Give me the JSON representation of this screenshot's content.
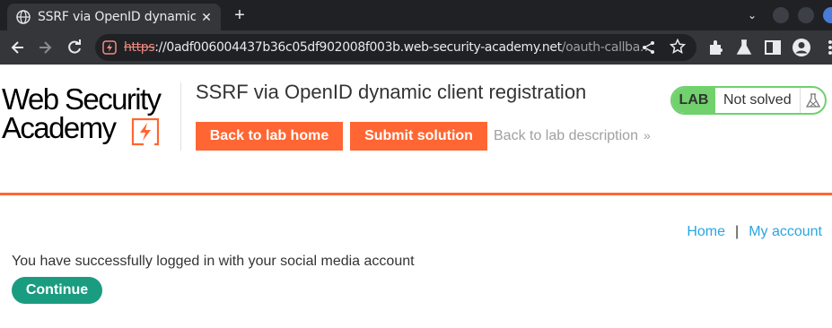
{
  "browser": {
    "tab_title": "SSRF via OpenID dynamic client registration",
    "tab_close_glyph": "✕",
    "new_tab_glyph": "+",
    "tabs_menu_glyph": "⌄",
    "url_scheme": "https",
    "url_host": "://0adf006004437b36c05df902008f003b.web-security-academy.net",
    "url_path": "/oauth-callba…",
    "icons": [
      "back-icon",
      "forward-icon",
      "reload-icon",
      "not-secure-icon",
      "share-icon",
      "bookmark-star-icon",
      "extensions-icon",
      "labs-flask-icon",
      "side-panel-icon",
      "profile-icon"
    ]
  },
  "header": {
    "logo_line1": "Web Security",
    "logo_line2": "Academy",
    "lab_title": "SSRF via OpenID dynamic client registration",
    "back_to_lab_home": "Back to lab home",
    "submit_solution": "Submit solution",
    "back_to_lab_description": "Back to lab description",
    "back_arrow_glyph": "»",
    "lab_badge": "LAB",
    "lab_status": "Not solved"
  },
  "nav": {
    "home": "Home",
    "separator": "|",
    "my_account": "My account"
  },
  "main": {
    "message": "You have successfully logged in with your social media account",
    "continue_button": "Continue"
  },
  "colors": {
    "brand_orange": "#ff6633",
    "lab_green": "#70d16d",
    "continue_teal": "#1a9c80",
    "link_blue": "#29a6e0"
  }
}
